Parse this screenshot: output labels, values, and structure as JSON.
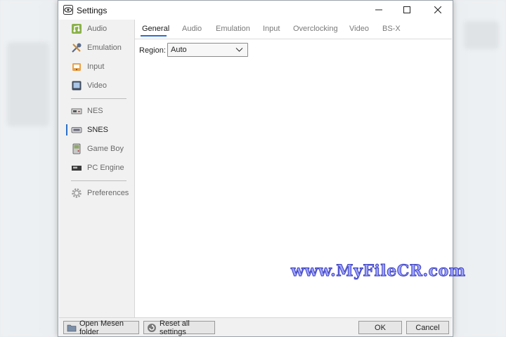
{
  "window": {
    "title": "Settings"
  },
  "sidebar": {
    "items": [
      {
        "label": "Audio",
        "icon": "speaker-icon"
      },
      {
        "label": "Emulation",
        "icon": "tools-icon"
      },
      {
        "label": "Input",
        "icon": "gamepad-icon"
      },
      {
        "label": "Video",
        "icon": "monitor-icon"
      },
      {
        "label": "NES",
        "icon": "nes-console-icon"
      },
      {
        "label": "SNES",
        "icon": "snes-console-icon",
        "selected": true
      },
      {
        "label": "Game Boy",
        "icon": "gameboy-icon"
      },
      {
        "label": "PC Engine",
        "icon": "pc-engine-icon"
      },
      {
        "label": "Preferences",
        "icon": "gear-icon"
      }
    ]
  },
  "tabs": [
    {
      "label": "General",
      "active": true
    },
    {
      "label": "Audio"
    },
    {
      "label": "Emulation"
    },
    {
      "label": "Input"
    },
    {
      "label": "Overclocking"
    },
    {
      "label": "Video"
    },
    {
      "label": "BS-X"
    }
  ],
  "general": {
    "region_label": "Region:",
    "region_value": "Auto"
  },
  "watermark": "www.MyFileCR.com",
  "footer": {
    "open_folder": "Open Mesen folder",
    "reset": "Reset all settings",
    "ok": "OK",
    "cancel": "Cancel"
  },
  "colors": {
    "accent": "#2a6fc8",
    "watermark_fill": "#9ea3ff",
    "watermark_stroke": "#3b3fbf"
  }
}
